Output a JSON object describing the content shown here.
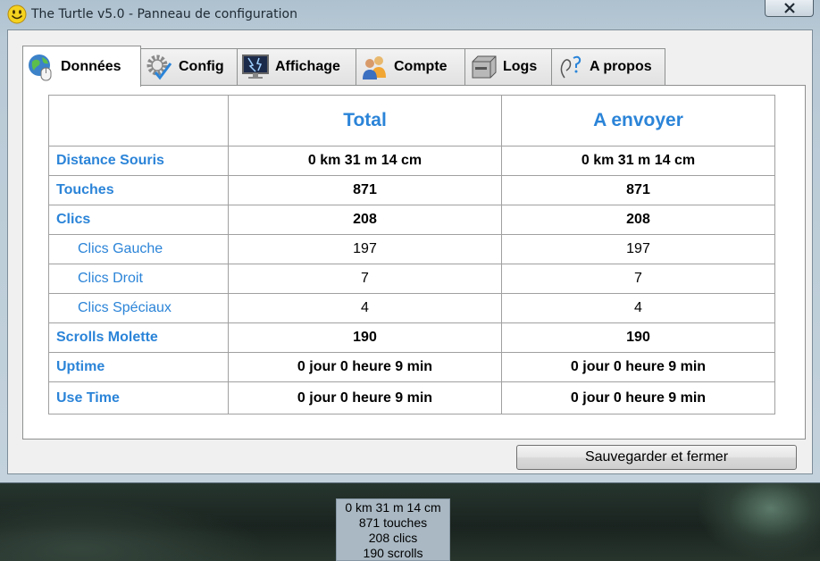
{
  "window": {
    "title": "The Turtle v5.0 - Panneau de configuration",
    "close_label": "✕"
  },
  "tabs": [
    {
      "label": "Données",
      "icon": "globe-mouse-icon",
      "active": true
    },
    {
      "label": "Config",
      "icon": "gear-check-icon",
      "active": false
    },
    {
      "label": "Affichage",
      "icon": "monitor-icon",
      "active": false
    },
    {
      "label": "Compte",
      "icon": "users-icon",
      "active": false
    },
    {
      "label": "Logs",
      "icon": "drive-icon",
      "active": false
    },
    {
      "label": "A propos",
      "icon": "question-icon",
      "active": false
    }
  ],
  "table": {
    "headers": [
      "Total",
      "A envoyer"
    ],
    "rows": [
      {
        "label": "Distance Souris",
        "total": "0 km 31 m 14 cm",
        "send": "0 km 31 m 14 cm"
      },
      {
        "label": "Touches",
        "total": "871",
        "send": "871"
      },
      {
        "label": "Clics",
        "total": "208",
        "send": "208"
      },
      {
        "label": "Clics Gauche",
        "total": "197",
        "send": "197"
      },
      {
        "label": "Clics Droit",
        "total": "7",
        "send": "7"
      },
      {
        "label": "Clics Spéciaux",
        "total": "4",
        "send": "4"
      },
      {
        "label": "Scrolls Molette",
        "total": "190",
        "send": "190"
      },
      {
        "label": "Uptime",
        "total": "0 jour 0 heure 9 min",
        "send": "0 jour 0 heure 9 min"
      },
      {
        "label": "Use Time",
        "total": "0 jour 0 heure 9 min",
        "send": "0 jour 0 heure 9 min"
      }
    ]
  },
  "save_button": "Sauvegarder et fermer",
  "tooltip": [
    "0 km 31 m 14 cm",
    "871 touches",
    "208 clics",
    "190 scrolls"
  ],
  "colors": {
    "accent": "#2b84d8"
  }
}
